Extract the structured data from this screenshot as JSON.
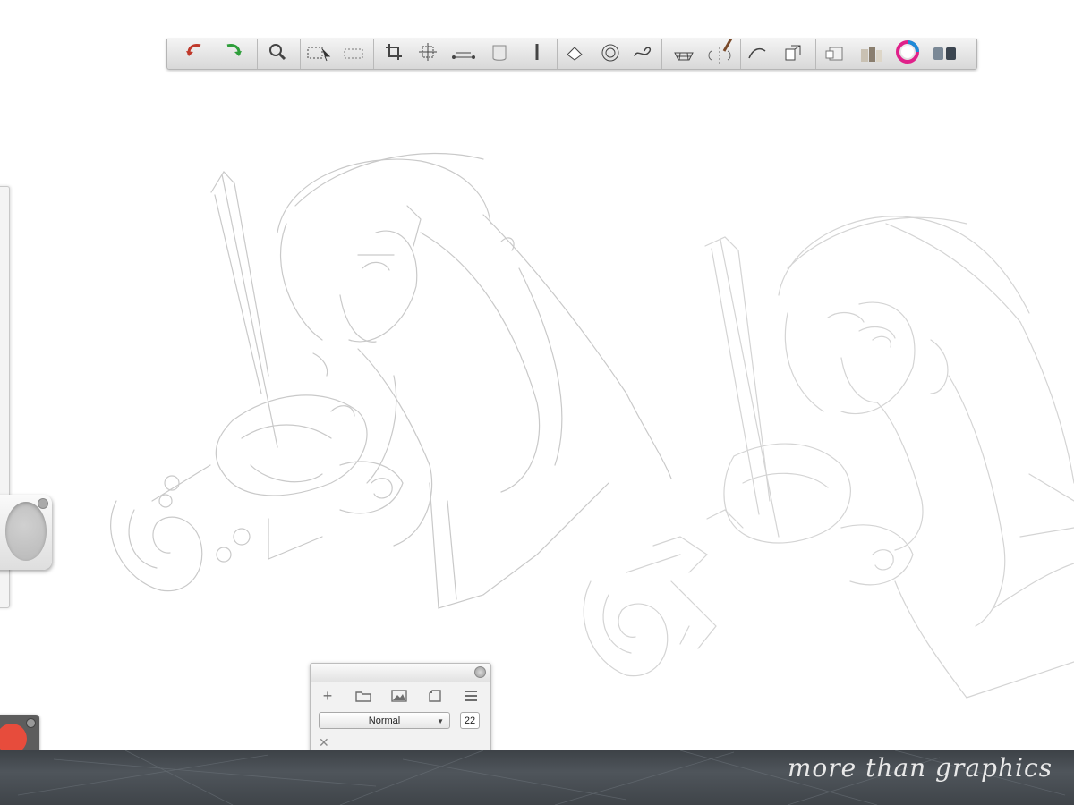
{
  "toolbar": {
    "tools": [
      {
        "name": "undo-icon"
      },
      {
        "name": "redo-icon"
      },
      {
        "name": "zoom-icon"
      },
      {
        "name": "select-icon"
      },
      {
        "name": "lasso-select-icon"
      },
      {
        "name": "crop-icon"
      },
      {
        "name": "transform-icon"
      },
      {
        "name": "perspective-icon"
      },
      {
        "name": "bucket-icon"
      },
      {
        "name": "text-icon"
      },
      {
        "name": "ruler-icon"
      },
      {
        "name": "ellipse-guide-icon"
      },
      {
        "name": "french-curve-icon"
      },
      {
        "name": "perspective-grid-icon"
      },
      {
        "name": "symmetry-icon"
      },
      {
        "name": "stroke-icon"
      },
      {
        "name": "flipbook-icon"
      },
      {
        "name": "layers-icon"
      },
      {
        "name": "brush-library-icon"
      },
      {
        "name": "color-wheel-icon"
      },
      {
        "name": "swatches-icon"
      }
    ]
  },
  "layers_panel": {
    "blend_mode": "Normal",
    "opacity": "22"
  },
  "banner": {
    "tagline": "more than graphics"
  },
  "colors": {
    "banner": "#474c52",
    "record": "#e74c3c",
    "color_well": "#c8c8c8"
  }
}
